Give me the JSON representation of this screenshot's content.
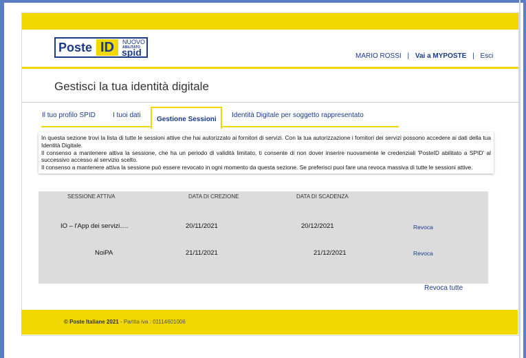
{
  "header": {
    "logo": {
      "brand": "Poste",
      "id": "ID",
      "nuovo": "NUOVO",
      "abilitato": "ABILITATO",
      "spid": "spid"
    },
    "user_name": "MARIO ROSSI",
    "sep1": "|",
    "myposte_link": "Vai a MYPOSTE",
    "sep2": "|",
    "logout": "Esci"
  },
  "page_title": "Gestisci la tua identità digitale",
  "tabs": [
    {
      "label": "Il tuo profilo SPID"
    },
    {
      "label": "I tuoi dati"
    },
    {
      "label": "Gestione Sessioni",
      "active": true
    },
    {
      "label": "Identità Digitale per soggetto rappresentato"
    }
  ],
  "info": {
    "p1": "In questa sezione trovi la lista di tutte le sessioni attive che hai autorizzato ai fornitori di servizi. Con la tua autorizzazione i fornitori dei servizi possono accedere ai dati della tua Identità Digitale.",
    "p2": "Il consenso a mantenere attiva la sessione, che ha un periodo di validità limitato, ti consente di non dover inserire nuovamente le credenziali 'PosteID abilitato a SPID' al successivo accesso al servizio scelto.",
    "p3": "Il consenso a mantenere attiva la sessione può essere revocato in ogni momento da questa sezione. Se preferisci puoi fare una revoca massiva di tutte le sessioni attive."
  },
  "table": {
    "headers": [
      "SESSIONE ATTIVA",
      "DATA DI CREZIONE",
      "DATA DI SCADENZA"
    ],
    "rows": [
      {
        "session": "IO – l'App dei servizi….",
        "created": "20/11/2021",
        "expires": "20/12/2021",
        "action": "Revoca"
      },
      {
        "session": "NoiPA",
        "created": "21/11/2021",
        "expires": "21/12/2021",
        "action": "Revoca"
      }
    ]
  },
  "revoke_all": "Revoca tutte",
  "footer": {
    "company": "© Poste Italiane 2021",
    "vat": " - Partita iva : 01114601006"
  },
  "colors": {
    "accent_yellow": "#f0d800",
    "brand_blue": "#1a3a8a",
    "table_bg": "#dcdcdc"
  }
}
